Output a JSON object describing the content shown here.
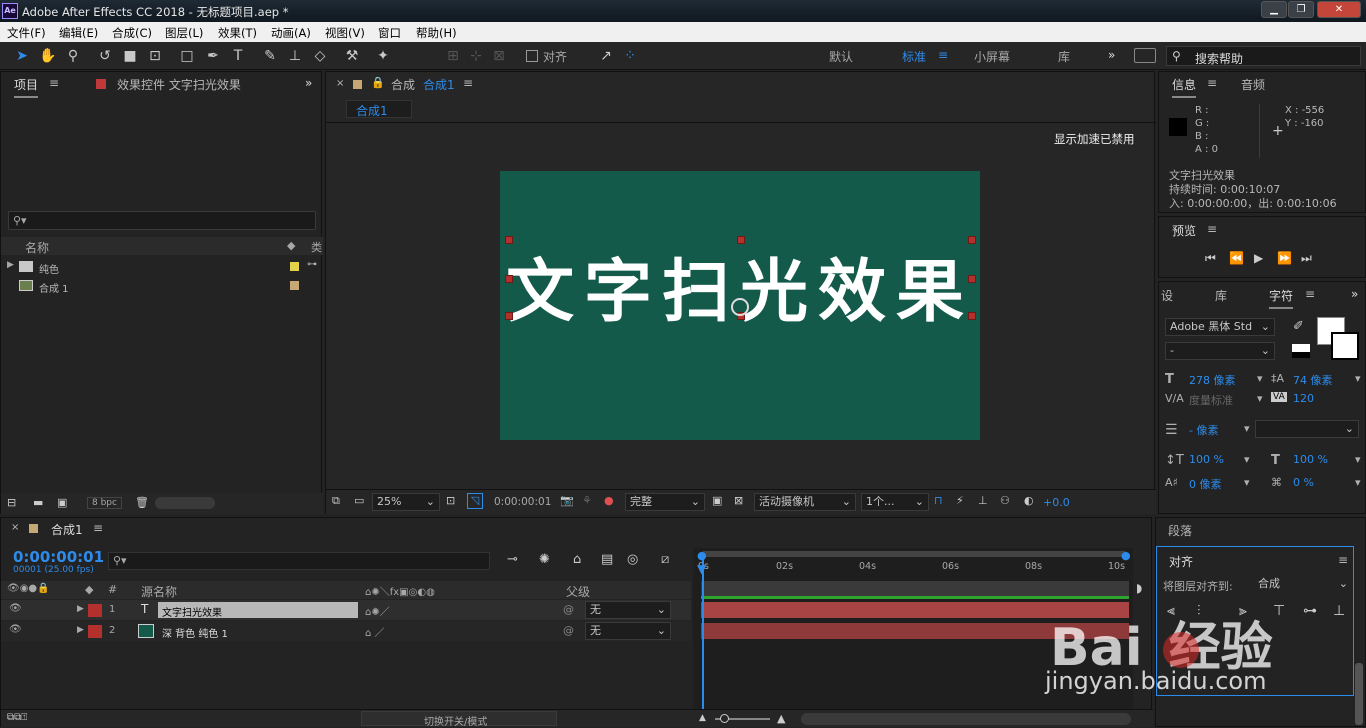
{
  "app": {
    "logo": "Ae",
    "title": "Adobe After Effects CC 2018 - 无标题项目.aep *",
    "minimize": "▁",
    "maximize": "❐",
    "close": "✕"
  },
  "menu": [
    "文件(F)",
    "编辑(E)",
    "合成(C)",
    "图层(L)",
    "效果(T)",
    "动画(A)",
    "视图(V)",
    "窗口",
    "帮助(H)"
  ],
  "toolbar": {
    "align_label": "对齐",
    "workspaces": [
      "默认",
      "标准",
      "小屏幕",
      "库"
    ],
    "active_workspace": "标准",
    "search_placeholder": "搜索帮助"
  },
  "project": {
    "tab": "项目",
    "effects_tab": "效果控件 文字扫光效果",
    "col_name": "名称",
    "col_type": "类",
    "items": [
      {
        "name": "纯色",
        "type": "folder",
        "label_color": "#e2d34a"
      },
      {
        "name": "合成 1",
        "type": "comp",
        "label_color": "#c7a875"
      }
    ],
    "bpc": "8 bpc"
  },
  "comp": {
    "tab_prefix": "合成",
    "tab_name": "合成1",
    "breadcrumb": "合成1",
    "accel_msg": "显示加速已禁用",
    "text": "文字扫光效果",
    "bg_color": "#135a4b",
    "zoom": "25%",
    "timecode": "0:00:00:01",
    "quality": "完整",
    "camera": "活动摄像机",
    "views": "1个...",
    "exposure": "+0.0"
  },
  "info": {
    "tab": "信息",
    "audio_tab": "音频",
    "r": "R :",
    "g": "G :",
    "b": "B :",
    "a": "A : 0",
    "x": "X : -556",
    "y": "Y : -160",
    "layer_name": "文字扫光效果",
    "duration": "持续时间: 0:00:10:07",
    "inout": "入: 0:00:00:00，出: 0:00:10:06"
  },
  "preview": {
    "tab": "预览"
  },
  "character": {
    "tab_set": "设",
    "tab_lib": "库",
    "tab": "字符",
    "font": "Adobe 黑体 Std",
    "style": "-",
    "size": "278 像素",
    "leading": "74 像素",
    "kerning": "度量标准",
    "tracking": "120",
    "indent": "- 像素",
    "vscale": "100 %",
    "hscale": "100 %",
    "baseline": "0 像素",
    "tsume": "0 %"
  },
  "paragraph": {
    "tab": "段落"
  },
  "align": {
    "tab": "对齐",
    "align_to_label": "将图层对齐到:",
    "align_to": "合成"
  },
  "timeline": {
    "tab": "合成1",
    "timecode": "0:00:00:01",
    "frames": "00001 (25.00 fps)",
    "col_src": "源名称",
    "col_parent": "父级",
    "switch_mode": "切换开关/模式",
    "ruler": [
      "0s",
      "02s",
      "04s",
      "06s",
      "08s",
      "10s"
    ],
    "layers": [
      {
        "num": "1",
        "type": "T",
        "name": "文字扫光效果",
        "parent": "无",
        "color": "#b3302d"
      },
      {
        "num": "2",
        "type": "",
        "name": "深 背色 纯色 1",
        "parent": "无",
        "color": "#b3302d"
      }
    ]
  },
  "watermark": {
    "brand": "Bai",
    "brand2": "经验",
    "url": "jingyan.baidu.com"
  }
}
